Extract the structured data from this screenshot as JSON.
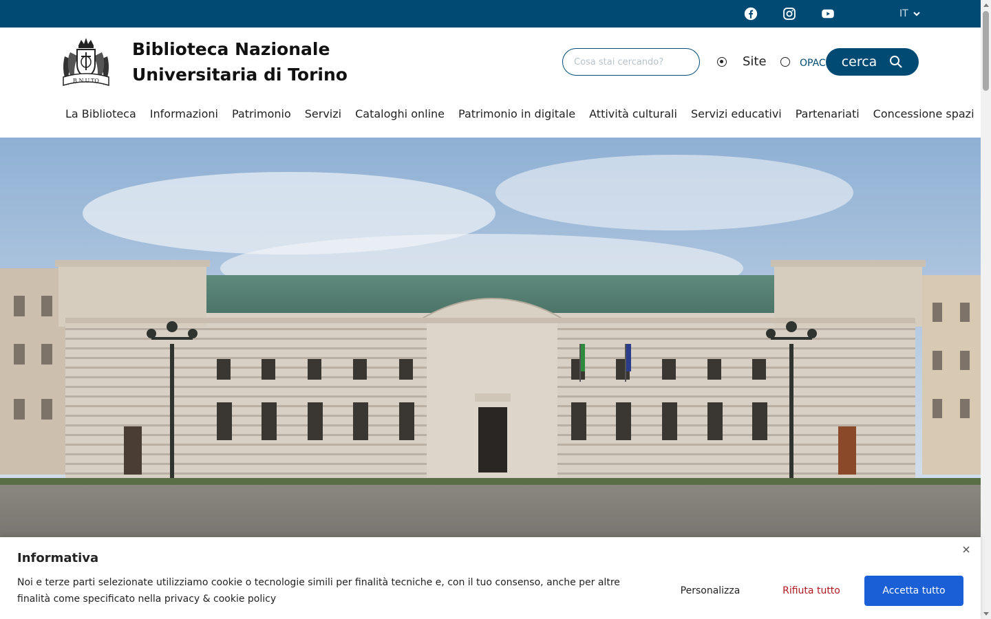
{
  "topbar": {
    "social": [
      {
        "name": "facebook-icon"
      },
      {
        "name": "instagram-icon"
      },
      {
        "name": "youtube-icon"
      }
    ],
    "language": "IT"
  },
  "header": {
    "logo_text": "B.N.U.TO",
    "title_line1": "Biblioteca Nazionale",
    "title_line2": "Universitaria di Torino"
  },
  "search": {
    "placeholder": "Cosa stai cercando?",
    "options": [
      {
        "label": "Site",
        "selected": true
      },
      {
        "label": "OPAC",
        "selected": false
      }
    ],
    "button_label": "cerca"
  },
  "nav": {
    "items": [
      "La Biblioteca",
      "Informazioni",
      "Patrimonio",
      "Servizi",
      "Cataloghi online",
      "Patrimonio in digitale",
      "Attività culturali",
      "Servizi educativi",
      "Partenariati",
      "Concessione spazi"
    ]
  },
  "cookie": {
    "title": "Informativa",
    "text": "Noi e terze parti selezionate utilizziamo cookie o tecnologie simili per finalità tecniche e, con il tuo consenso, anche per altre finalità come specificato nella ",
    "link": "privacy & cookie policy",
    "buttons": {
      "customize": "Personalizza",
      "reject": "Rifiuta tutto",
      "accept": "Accetta tutto"
    }
  },
  "colors": {
    "brand": "#004a73",
    "accept": "#1a5fd6",
    "reject": "#b0171f"
  }
}
